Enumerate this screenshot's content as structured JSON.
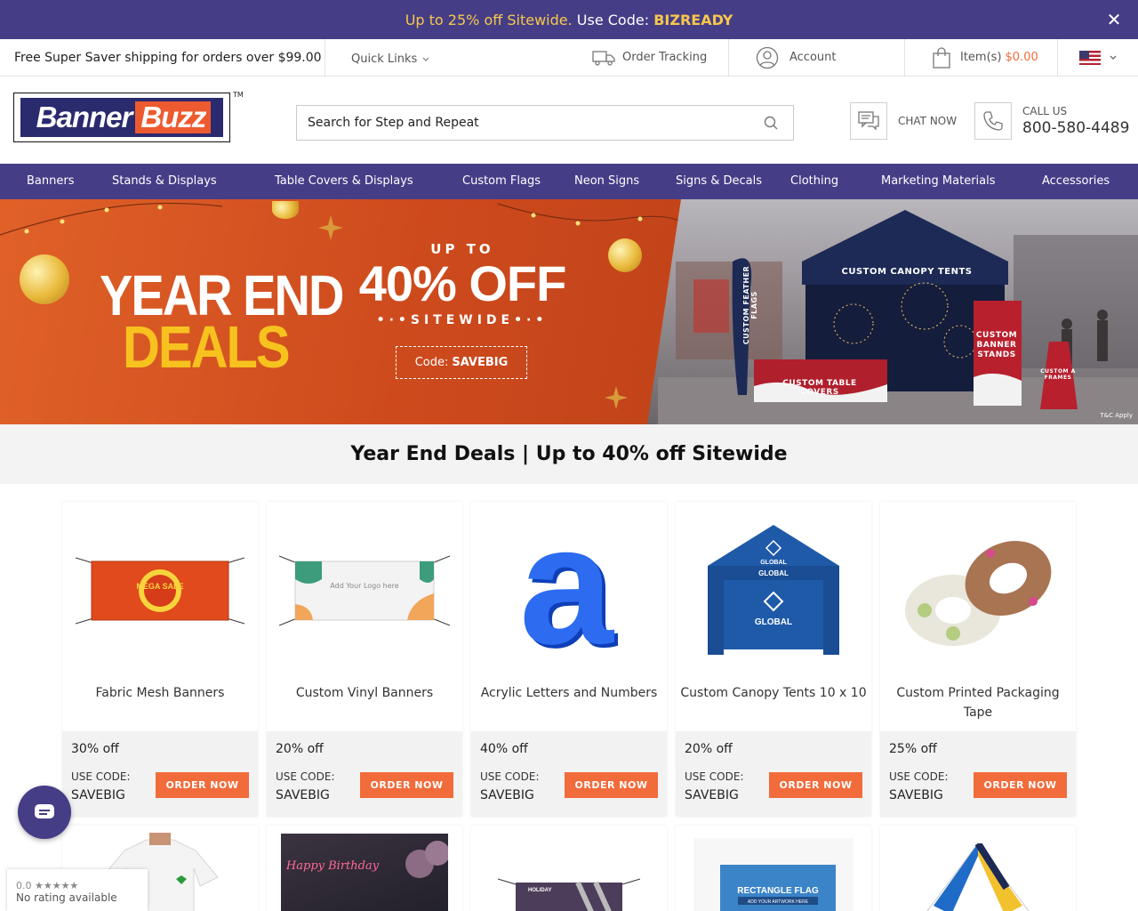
{
  "promo": {
    "lead": "Up to 25% off Sitewide.",
    "use_code": "Use Code:",
    "code": "BIZREADY",
    "close_glyph": "✕"
  },
  "utility": {
    "shipping": "Free Super Saver shipping for orders over $99.00",
    "quick_links": "Quick Links",
    "order_tracking": "Order Tracking",
    "account": "Account",
    "items": "Item(s)",
    "cart_total": "$0.00"
  },
  "header": {
    "logo_banner": "Banner",
    "logo_buzz": "Buzz",
    "tm": "TM",
    "search_value": "Search for Step and Repeat",
    "chat_label": "CHAT NOW",
    "call_label": "CALL US",
    "call_number": "800-580-4489"
  },
  "nav": {
    "items": [
      "Banners",
      "Stands & Displays",
      "Table Covers & Displays",
      "Custom Flags",
      "Neon Signs",
      "Signs & Decals",
      "Clothing",
      "Marketing Materials",
      "Accessories"
    ]
  },
  "hero": {
    "title1": "YEAR END",
    "title2": "DEALS",
    "up_to": "UP TO",
    "percent": "40% OFF",
    "sitewide": "•·•SITEWIDE•·•",
    "code_label": "Code:",
    "code": "SAVEBIG",
    "canopy": "CUSTOM CANOPY TENTS",
    "feather": "CUSTOM FEATHER FLAGS",
    "table": "CUSTOM TABLE COVERS",
    "stands": "CUSTOM BANNER STANDS",
    "aframes": "CUSTOM A FRAMES",
    "tc": "T&C Apply"
  },
  "section": {
    "title": "Year End Deals | Up to 40% off Sitewide"
  },
  "products": [
    {
      "name": "Fabric Mesh Banners",
      "discount": "30% off",
      "use_code": "USE CODE:",
      "code": "SAVEBIG",
      "button": "ORDER NOW"
    },
    {
      "name": "Custom Vinyl Banners",
      "discount": "20% off",
      "use_code": "USE CODE:",
      "code": "SAVEBIG",
      "button": "ORDER NOW"
    },
    {
      "name": "Acrylic Letters and Numbers",
      "discount": "40% off",
      "use_code": "USE CODE:",
      "code": "SAVEBIG",
      "button": "ORDER NOW"
    },
    {
      "name": "Custom Canopy Tents 10 x 10",
      "discount": "20% off",
      "use_code": "USE CODE:",
      "code": "SAVEBIG",
      "button": "ORDER NOW"
    },
    {
      "name": "Custom Printed Packaging Tape",
      "discount": "25% off",
      "use_code": "USE CODE:",
      "code": "SAVEBIG",
      "button": "ORDER NOW"
    }
  ],
  "product_images": {
    "mega_sale": "MEGA SALE",
    "vinyl_logo": "Add Your Logo here",
    "acrylic_letter": "a",
    "global": "GLOBAL",
    "holiday": "HOLIDAY",
    "happy_birthday": "Happy Birthday",
    "rectangle_flag": "RECTANGLE FLAG",
    "rectangle_sub": "ADD YOUR ARTWORK HERE"
  },
  "rating": {
    "score": "0.0 ★★★★★",
    "text": "No rating available"
  }
}
